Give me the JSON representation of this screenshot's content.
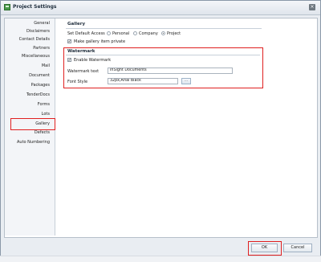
{
  "window": {
    "title": "Project Settings",
    "close_label": "×"
  },
  "nav": {
    "items": [
      {
        "label": "General"
      },
      {
        "label": "Disclaimers"
      },
      {
        "label": "Contact Details"
      },
      {
        "label": "Partners"
      },
      {
        "label": "Miscellaneous"
      },
      {
        "label": "Mail"
      },
      {
        "label": "Document"
      },
      {
        "label": "Packages"
      },
      {
        "label": "TenderDocs"
      },
      {
        "label": "Forms"
      },
      {
        "label": "Lots"
      },
      {
        "label": "Gallery"
      },
      {
        "label": "Defects"
      },
      {
        "label": "Auto Numbering"
      }
    ],
    "selected": "Gallery"
  },
  "gallery": {
    "title": "Gallery",
    "access_label": "Set Default Access",
    "options": [
      {
        "label": "Personal",
        "selected": false
      },
      {
        "label": "Company",
        "selected": false
      },
      {
        "label": "Project",
        "selected": true
      }
    ],
    "private_label": "Make gallery item private",
    "private_checked": true
  },
  "watermark": {
    "title": "Watermark",
    "enable_label": "Enable Watermark",
    "enable_checked": true,
    "text_label": "Watermark text",
    "text_value": "InSight Documents",
    "font_label": "Font Style",
    "font_value": "32px,Arial Black",
    "browse_label": "..."
  },
  "footer": {
    "ok_label": "OK",
    "cancel_label": "Cancel"
  },
  "colors": {
    "highlight": "#e02020"
  }
}
